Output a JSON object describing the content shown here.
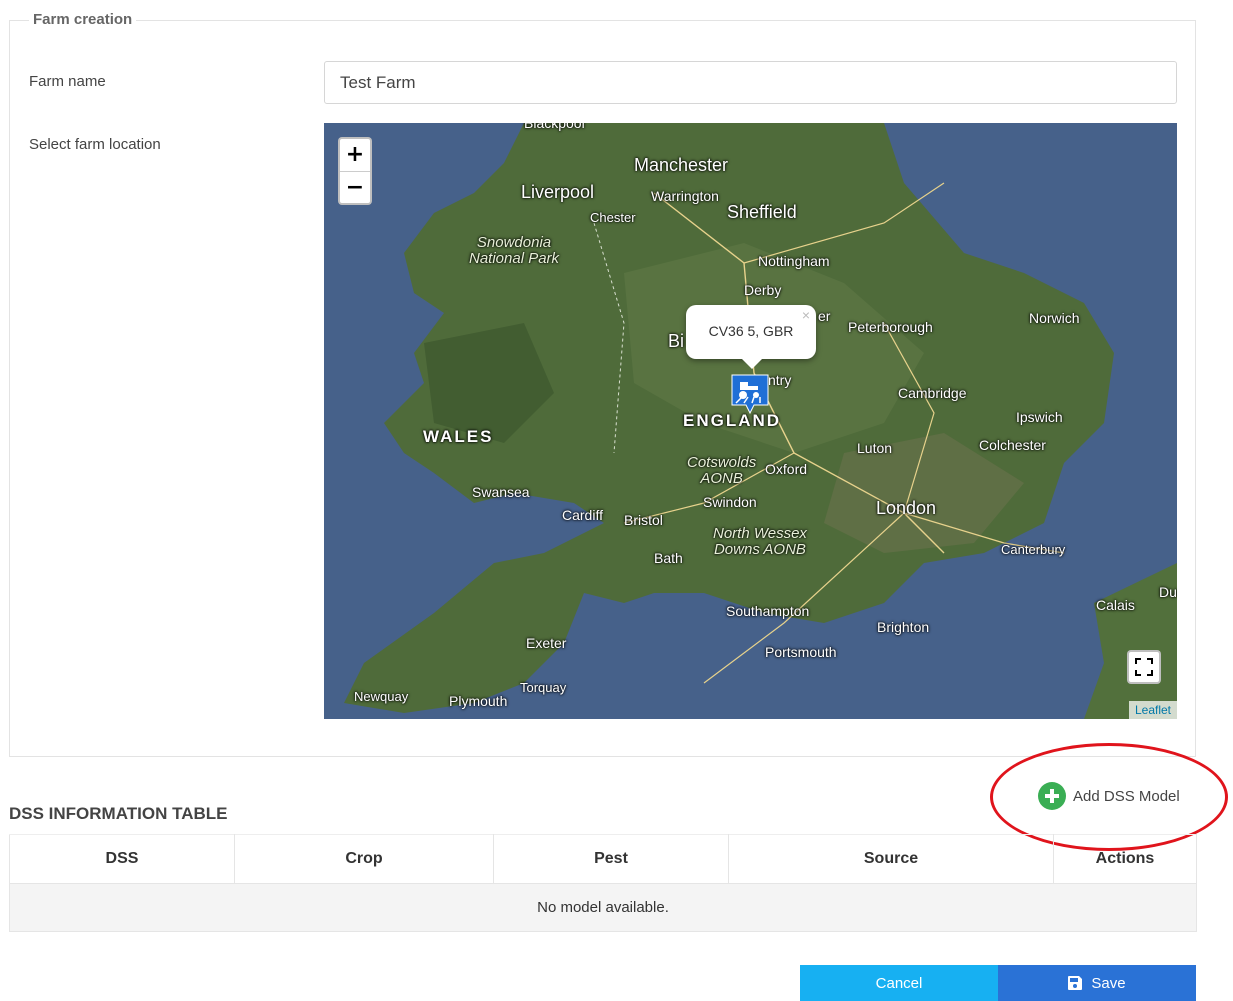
{
  "form": {
    "legend": "Farm creation",
    "farm_name_label": "Farm name",
    "farm_name_value": "Test Farm",
    "location_label": "Select farm location"
  },
  "map": {
    "zoom_in": "+",
    "zoom_out": "−",
    "popup_text": "CV36 5, GBR",
    "popup_close": "×",
    "attribution": "Leaflet",
    "places": {
      "blackpool": "Blackpool",
      "manchester": "Manchester",
      "liverpool": "Liverpool",
      "warrington": "Warrington",
      "chester": "Chester",
      "sheffield": "Sheffield",
      "snowdonia": "Snowdonia\nNational Park",
      "nottingham": "Nottingham",
      "derby": "Derby",
      "leicester_partial": "er",
      "peterborough": "Peterborough",
      "norwich": "Norwich",
      "birmingham_partial": "Bi",
      "coventry_partial": "ntry",
      "cambridge": "Cambridge",
      "ipswich": "Ipswich",
      "england": "ENGLAND",
      "wales": "WALES",
      "luton": "Luton",
      "colchester": "Colchester",
      "cotswolds": "Cotswolds\nAONB",
      "oxford": "Oxford",
      "swansea": "Swansea",
      "swindon": "Swindon",
      "london": "London",
      "cardiff": "Cardiff",
      "bristol": "Bristol",
      "north_wessex": "North Wessex\nDowns AONB",
      "bath": "Bath",
      "canterbury": "Canterbury",
      "dunkirk_partial": "Dunk",
      "calais": "Calais",
      "southampton": "Southampton",
      "brighton": "Brighton",
      "exeter": "Exeter",
      "portsmouth": "Portsmouth",
      "torquay": "Torquay",
      "newquay": "Newquay",
      "plymouth": "Plymouth"
    }
  },
  "dss": {
    "add_label": "Add DSS Model",
    "table_title": "DSS INFORMATION TABLE",
    "columns": [
      "DSS",
      "Crop",
      "Pest",
      "Source",
      "Actions"
    ],
    "empty_message": "No model available."
  },
  "actions": {
    "cancel": "Cancel",
    "save": "Save"
  },
  "colors": {
    "cancel": "#17b0f2",
    "save": "#2a72d6",
    "add_icon": "#3aae54",
    "highlight": "#e0141c"
  }
}
